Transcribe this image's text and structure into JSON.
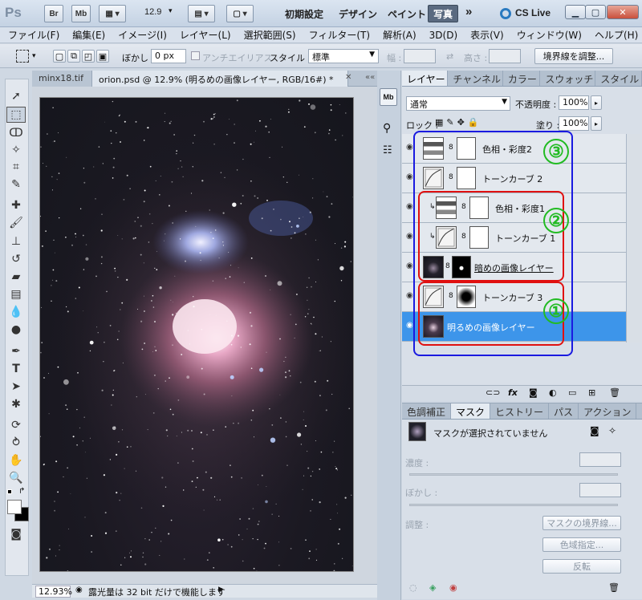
{
  "titlebar": {
    "logo": "Ps",
    "br": "Br",
    "mb": "Mb",
    "zoom": "12.9",
    "ws_essentials": "初期設定",
    "ws_design": "デザイン",
    "ws_paint": "ペイント",
    "ws_photo": "写真",
    "more": "»",
    "cslive": "CS Live"
  },
  "menu": [
    "ファイル(F)",
    "編集(E)",
    "イメージ(I)",
    "レイヤー(L)",
    "選択範囲(S)",
    "フィルター(T)",
    "解析(A)",
    "3D(D)",
    "表示(V)",
    "ウィンドウ(W)",
    "ヘルプ(H)"
  ],
  "options": {
    "feather_label": "ぼかし :",
    "feather_value": "0 px",
    "antialias": "アンチエイリアス",
    "style_label": "スタイル :",
    "style_value": "標準",
    "width_label": "幅 :",
    "height_label": "高さ :",
    "refine_button": "境界線を調整..."
  },
  "document": {
    "tab_inactive": "minx18.tif",
    "tab_active": "orion.psd @ 12.9% (明るめの画像レイヤー, RGB/16#) *",
    "zoom_status": "12.93%",
    "status_text": "露光量は 32 bit だけで機能します"
  },
  "layers_panel": {
    "tabs": [
      "レイヤー",
      "チャンネル",
      "カラー",
      "スウォッチ",
      "スタイル"
    ],
    "blend_mode": "通常",
    "opacity_label": "不透明度 :",
    "opacity_value": "100%",
    "lock_label": "ロック :",
    "fill_label": "塗り :",
    "fill_value": "100%",
    "layers": [
      {
        "name": "色相・彩度2"
      },
      {
        "name": "トーンカーブ 2"
      },
      {
        "name": "色相・彩度1"
      },
      {
        "name": "トーンカーブ 1"
      },
      {
        "name": "暗めの画像レイヤー"
      },
      {
        "name": "トーンカーブ 3"
      },
      {
        "name": "明るめの画像レイヤー"
      }
    ],
    "markers": [
      "③",
      "②",
      "①"
    ],
    "colors": {
      "selection": "#3d95ea",
      "group_blue": "#1a1ae0",
      "group_red": "#e01010",
      "marker_green": "#22bb22"
    }
  },
  "mask_panel": {
    "tabs": [
      "色調補正",
      "マスク",
      "ヒストリー",
      "パス",
      "アクション"
    ],
    "status": "マスクが選択されていません",
    "density_label": "濃度 :",
    "feather_label": "ぼかし :",
    "adjust_label": "調整 :",
    "btn_edge": "マスクの境界線...",
    "btn_color_range": "色域指定...",
    "btn_invert": "反転"
  }
}
